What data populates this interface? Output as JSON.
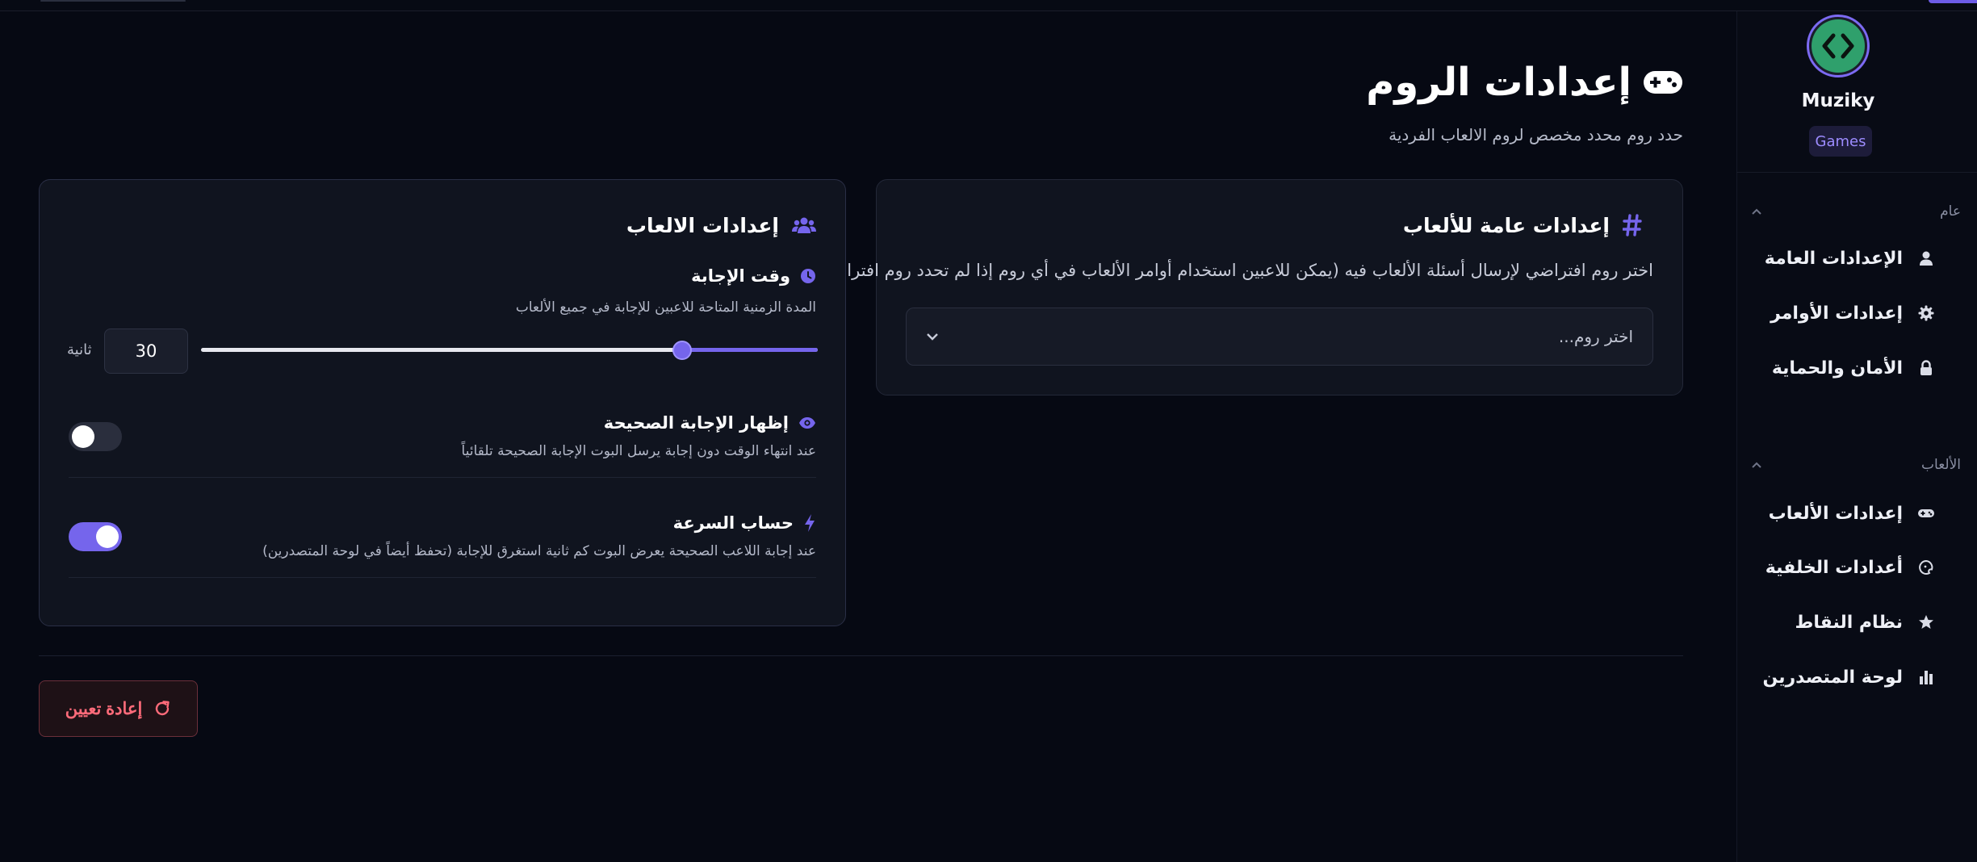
{
  "sidebar": {
    "brand_name": "Muziky",
    "brand_badge": "Games",
    "sections": [
      {
        "title": "عام",
        "items": [
          {
            "label": "الإعدادات العامة",
            "icon": "user-icon"
          },
          {
            "label": "إعدادات الأوامر",
            "icon": "gear-icon"
          },
          {
            "label": "الأمان والحماية",
            "icon": "lock-icon"
          }
        ]
      },
      {
        "title": "الألعاب",
        "items": [
          {
            "label": "إعدادات الألعاب",
            "icon": "gamepad-icon"
          },
          {
            "label": "أعدادات الخلفية",
            "icon": "palette-icon"
          },
          {
            "label": "نظام النقاط",
            "icon": "star-icon"
          },
          {
            "label": "لوحة المتصدرين",
            "icon": "bar-chart-icon"
          }
        ]
      }
    ]
  },
  "header": {
    "title": "إعدادات الروم",
    "subtitle": "حدد روم محدد مخصص لروم الالعاب الفردية"
  },
  "general_card": {
    "title": "إعدادات عامة للألعاب",
    "description": "اختر روم افتراضي لإرسال أسئلة الألعاب فيه (يمكن للاعبين استخدام أوامر الألعاب في أي روم إذا لم تحدد روم افتراضي)",
    "select_placeholder": "اختر روم..."
  },
  "games_card": {
    "title": "إعدادات الالعاب",
    "answer_time": {
      "title": "وقت الإجابة",
      "description": "المدة الزمنية المتاحة للاعبين للإجابة في جميع الألعاب",
      "value": "30",
      "unit": "ثانية",
      "slider_fraction": 0.22
    },
    "show_answer": {
      "title": "إظهار الإجابة الصحيحة",
      "description": "عند انتهاء الوقت دون إجابة يرسل البوت الإجابة الصحيحة تلقائياً",
      "enabled": false
    },
    "speed_calc": {
      "title": "حساب السرعة",
      "description": "عند إجابة اللاعب الصحيحة يعرض البوت كم ثانية استغرق للإجابة (تحفظ أيضاً في لوحة المتصدرين)",
      "enabled": true
    }
  },
  "reset_button": {
    "label": "إعادة تعيين"
  },
  "colors": {
    "accent": "#7565ec",
    "danger": "#ff6b7a",
    "background": "#060913",
    "card": "#10141f"
  }
}
